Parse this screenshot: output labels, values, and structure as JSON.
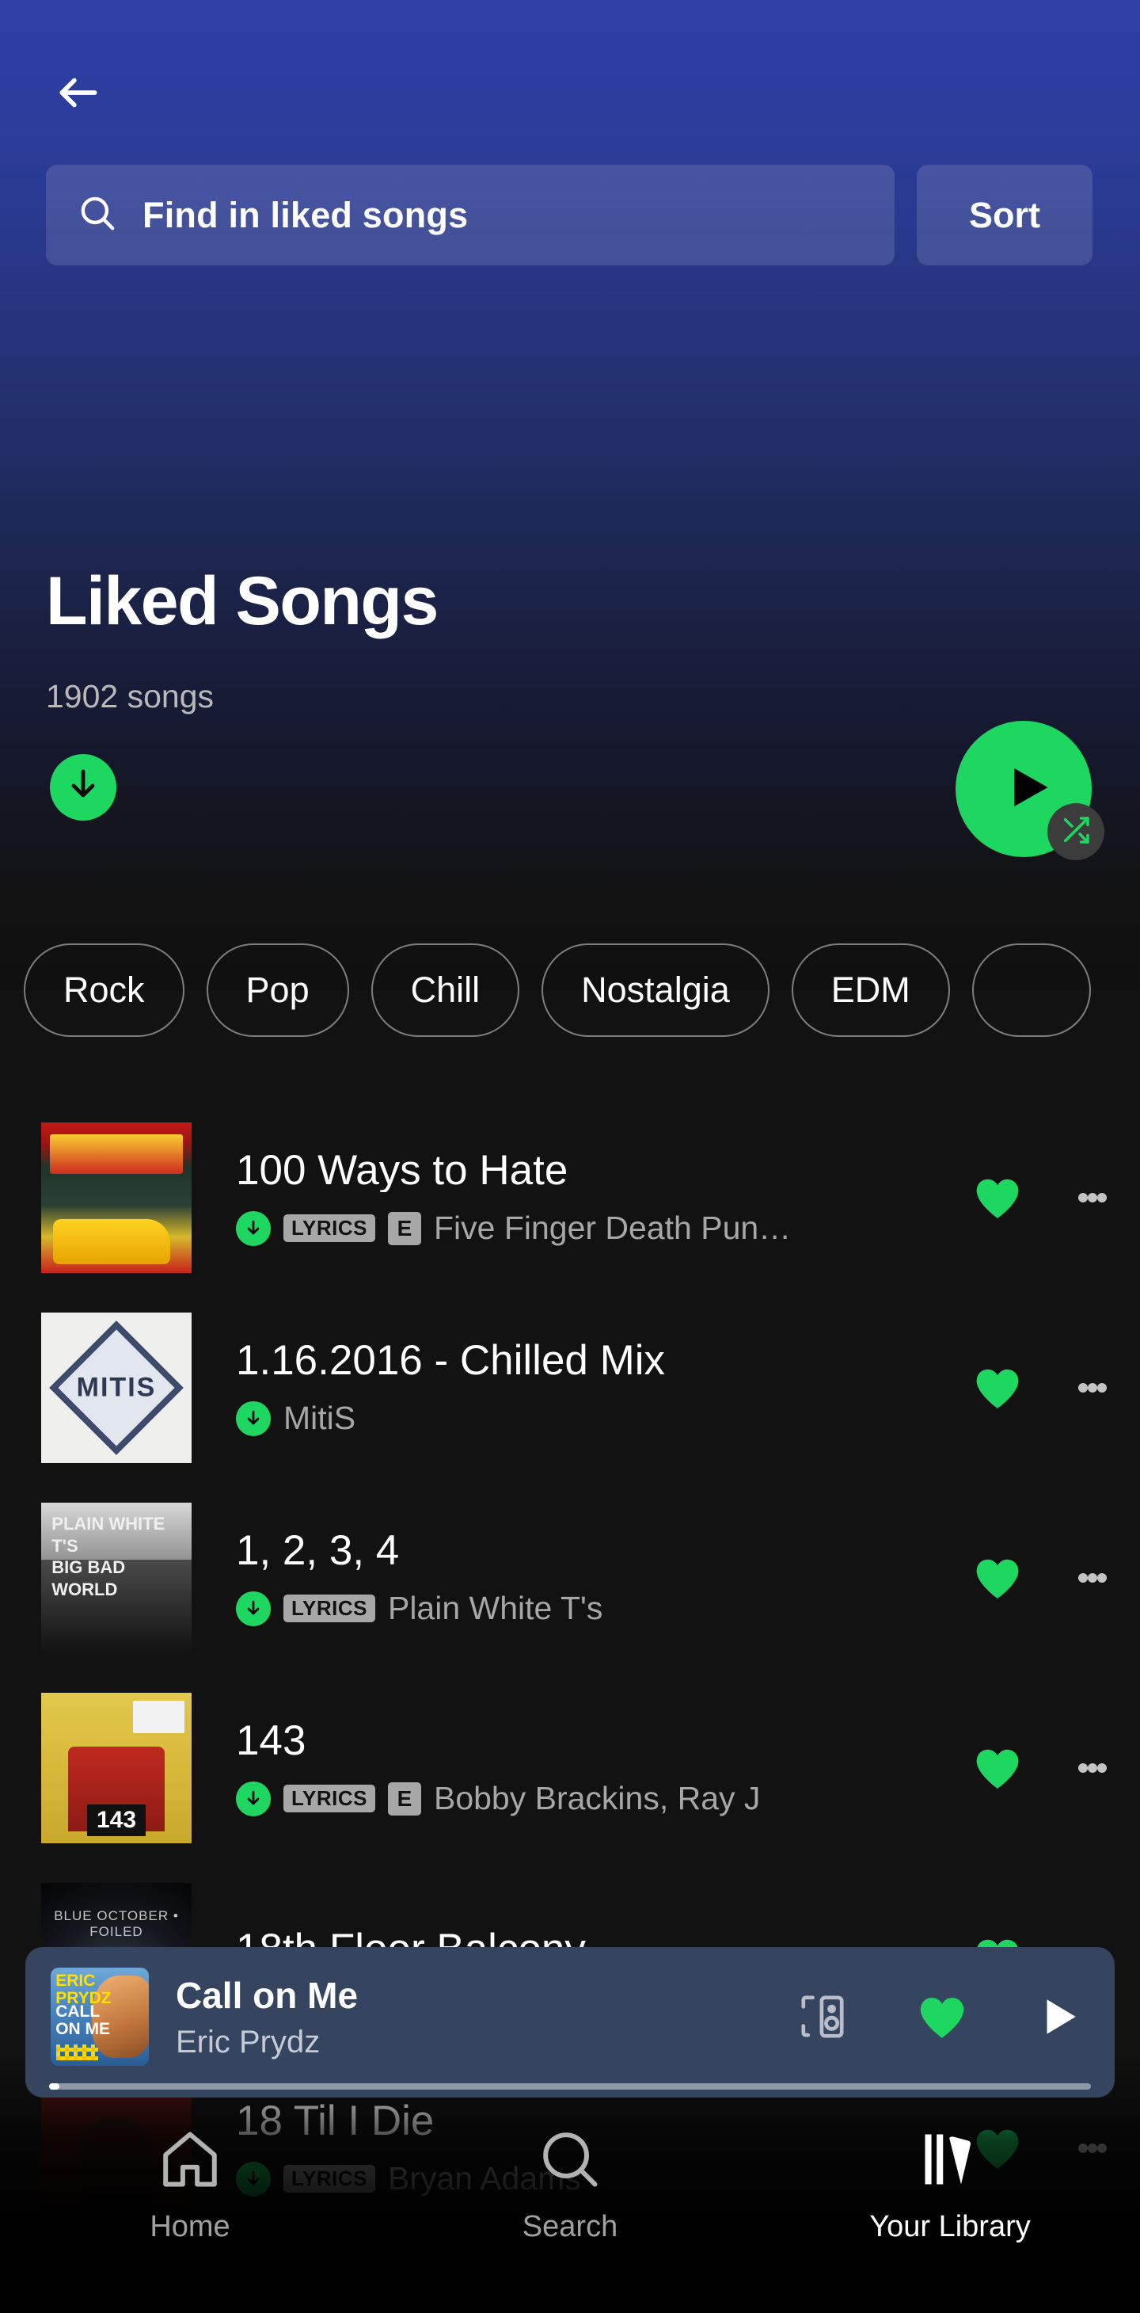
{
  "colors": {
    "accent_green": "#1ed760",
    "hero_top": "#2e3fa7",
    "page_bg": "#121212",
    "nowplaying_bg": "#35445f",
    "muted_text": "#a7a7a7"
  },
  "header": {
    "back_icon": "back-arrow-icon",
    "search": {
      "icon": "search-icon",
      "placeholder": "Find in liked songs",
      "value": ""
    },
    "sort_label": "Sort"
  },
  "playlist": {
    "title": "Liked Songs",
    "song_count_label": "1902 songs",
    "download_icon": "download-icon",
    "play_icon": "play-icon",
    "shuffle_icon": "shuffle-icon"
  },
  "filters": {
    "chips": [
      {
        "label": "Rock"
      },
      {
        "label": "Pop"
      },
      {
        "label": "Chill"
      },
      {
        "label": "Nostalgia"
      },
      {
        "label": "EDM"
      },
      {
        "label": ""
      }
    ]
  },
  "tracks": [
    {
      "title": "100 Ways to Hate",
      "artist": "Five Finger Death Pun…",
      "downloaded": true,
      "lyrics_badge": "LYRICS",
      "explicit_badge": "E",
      "liked": true,
      "art": "aa-ffdp",
      "art_label": ""
    },
    {
      "title": "1.16.2016 - Chilled Mix",
      "artist": "MitiS",
      "downloaded": true,
      "lyrics_badge": "",
      "explicit_badge": "",
      "liked": true,
      "art": "aa-mitis",
      "art_label": "MITIS"
    },
    {
      "title": "1, 2, 3, 4",
      "artist": "Plain White T's",
      "downloaded": true,
      "lyrics_badge": "LYRICS",
      "explicit_badge": "",
      "liked": true,
      "art": "aa-pwt",
      "art_label": "PLAIN WHITE T'S\nBIG BAD WORLD"
    },
    {
      "title": "143",
      "artist": "Bobby Brackins, Ray J",
      "downloaded": true,
      "lyrics_badge": "LYRICS",
      "explicit_badge": "E",
      "liked": true,
      "art": "aa-143",
      "art_label": "143"
    },
    {
      "title": "18th Floor Balcony",
      "artist": "",
      "downloaded": false,
      "lyrics_badge": "",
      "explicit_badge": "",
      "liked": true,
      "art": "aa-blue",
      "art_label": "BLUE OCTOBER • FOILED"
    },
    {
      "title": "18 Til I Die",
      "artist": "Bryan Adams",
      "downloaded": true,
      "lyrics_badge": "LYRICS",
      "explicit_badge": "",
      "liked": true,
      "art": "aa-bryan",
      "art_label": ""
    }
  ],
  "now_playing": {
    "title": "Call on Me",
    "artist": "Eric Prydz",
    "devices_icon": "devices-icon",
    "like_icon": "heart-filled-icon",
    "play_icon": "play-icon",
    "progress_percent": 1,
    "art_line1": "ERIC\nPRYDZ",
    "art_line2": "CALL\nON ME"
  },
  "bottom_nav": {
    "items": [
      {
        "label": "Home",
        "icon": "home-icon",
        "active": false
      },
      {
        "label": "Search",
        "icon": "search-icon",
        "active": false
      },
      {
        "label": "Your Library",
        "icon": "library-icon",
        "active": true
      }
    ]
  }
}
